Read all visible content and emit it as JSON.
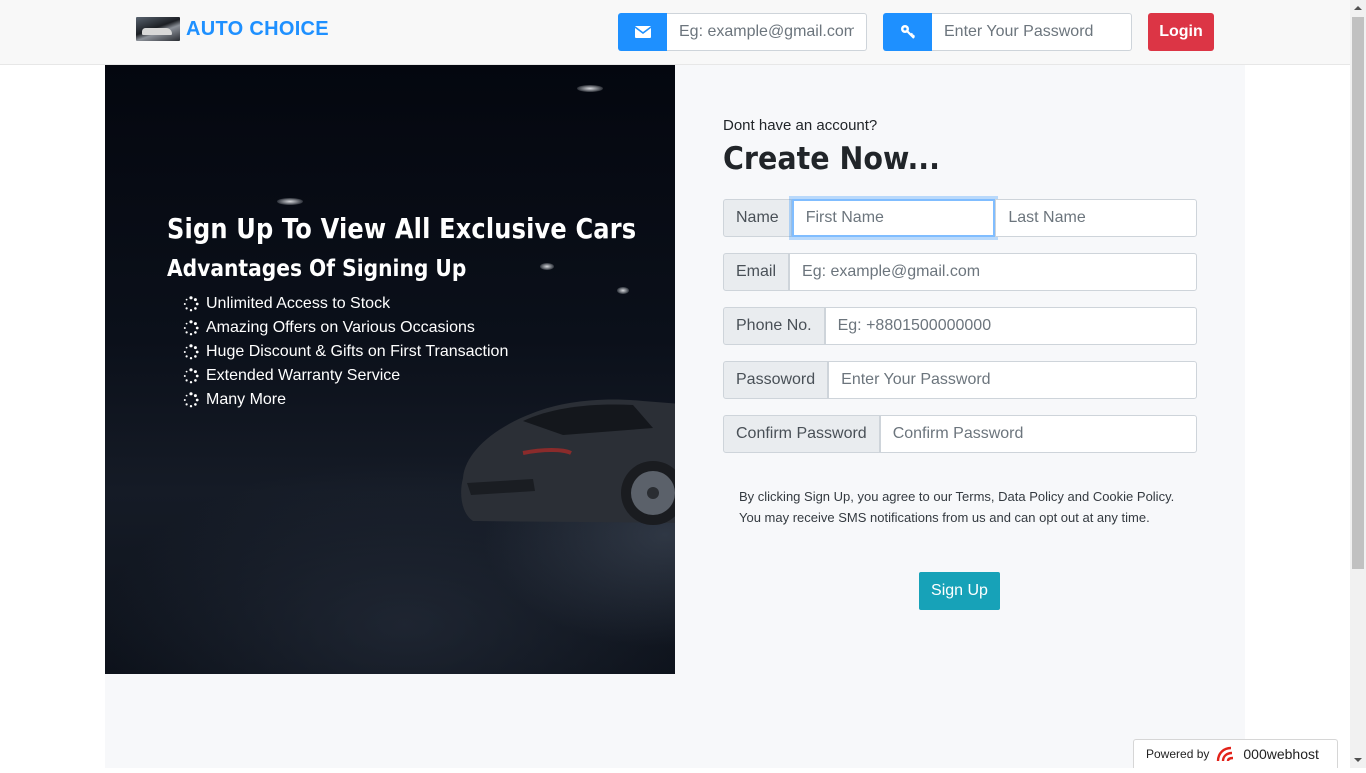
{
  "navbar": {
    "brand_name": "AUTO CHOICE",
    "email_placeholder": "Eg: example@gmail.com",
    "password_placeholder": "Enter Your Password",
    "login_label": "Login",
    "accent_color": "#1e90ff",
    "login_color": "#dc3545"
  },
  "hero": {
    "title": "Sign Up To View All Exclusive Cars",
    "subtitle": "Advantages Of Signing Up",
    "advantages": [
      "Unlimited Access to Stock",
      "Amazing Offers on Various Occasions",
      "Huge Discount & Gifts on First Transaction",
      "Extended Warranty Service",
      "Many More"
    ]
  },
  "signup": {
    "question": "Dont have an account?",
    "heading": "Create Now...",
    "name_label": "Name",
    "first_name_placeholder": "First Name",
    "last_name_placeholder": "Last Name",
    "email_label": "Email",
    "email_placeholder": "Eg: example@gmail.com",
    "phone_label": "Phone No.",
    "phone_placeholder": "Eg: +8801500000000",
    "password_label": "Passoword",
    "password_placeholder": "Enter Your Password",
    "confirm_label": "Confirm Password",
    "confirm_placeholder": "Confirm Password",
    "policy_text": "By clicking Sign Up, you agree to our Terms, Data Policy and Cookie Policy. You may receive SMS notifications from us and can opt out at any time.",
    "signup_label": "Sign Up",
    "signup_color": "#17a2b8"
  },
  "footer_badge": {
    "powered_by": "Powered by",
    "host_name": "000webhost"
  }
}
